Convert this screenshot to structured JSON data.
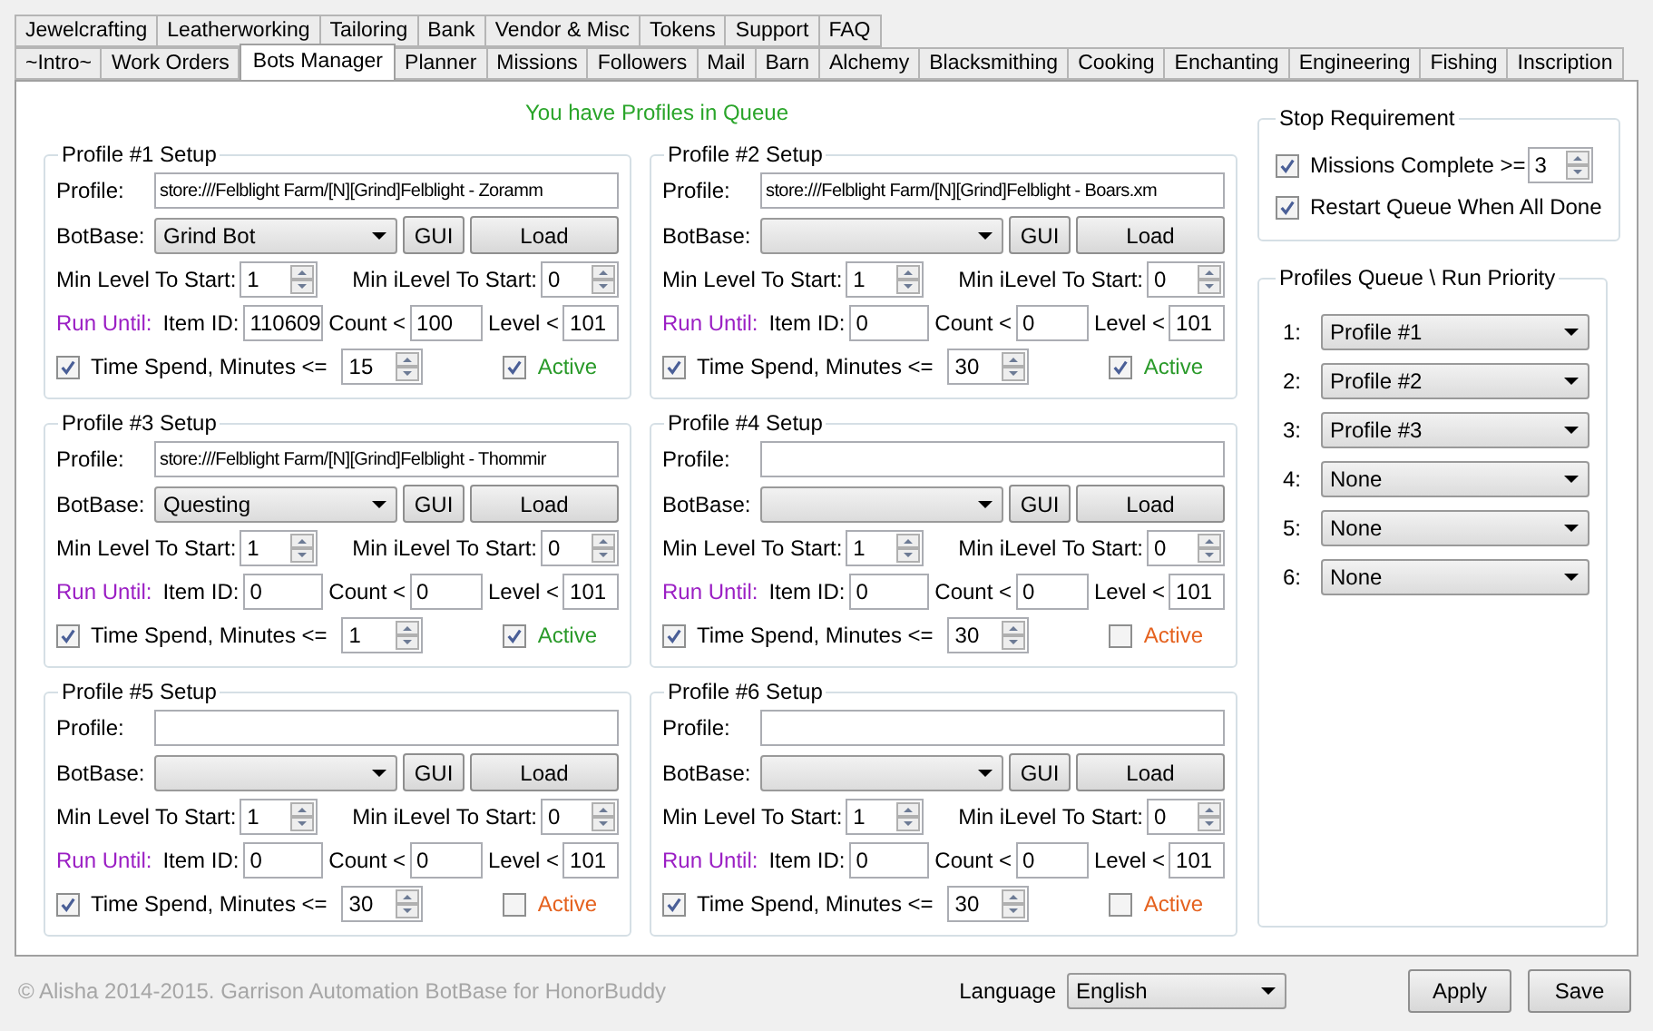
{
  "tabs_row_1": [
    {
      "label": "Jewelcrafting",
      "selected": false
    },
    {
      "label": "Leatherworking",
      "selected": false
    },
    {
      "label": "Tailoring",
      "selected": false
    },
    {
      "label": "Bank",
      "selected": false
    },
    {
      "label": "Vendor & Misc",
      "selected": false
    },
    {
      "label": "Tokens",
      "selected": false
    },
    {
      "label": "Support",
      "selected": false
    },
    {
      "label": "FAQ",
      "selected": false
    }
  ],
  "tabs_row_2": [
    {
      "label": "~Intro~",
      "selected": false
    },
    {
      "label": "Work Orders",
      "selected": false
    },
    {
      "label": "Bots Manager",
      "selected": true
    },
    {
      "label": "Planner",
      "selected": false
    },
    {
      "label": "Missions",
      "selected": false
    },
    {
      "label": "Followers",
      "selected": false
    },
    {
      "label": "Mail",
      "selected": false
    },
    {
      "label": "Barn",
      "selected": false
    },
    {
      "label": "Alchemy",
      "selected": false
    },
    {
      "label": "Blacksmithing",
      "selected": false
    },
    {
      "label": "Cooking",
      "selected": false
    },
    {
      "label": "Enchanting",
      "selected": false
    },
    {
      "label": "Engineering",
      "selected": false
    },
    {
      "label": "Fishing",
      "selected": false
    },
    {
      "label": "Inscription",
      "selected": false
    }
  ],
  "status_message": "You have Profiles in Queue",
  "profiles": [
    {
      "title": "Profile #1 Setup",
      "profile_label": "Profile:",
      "profile_path": "store:///Felblight Farm/[N][Grind]Felblight - Zoramm",
      "botbase_label": "BotBase:",
      "botbase": "Grind Bot",
      "gui_button": "GUI",
      "load_button": "Load",
      "min_level_label": "Min Level To Start:",
      "min_level": "1",
      "min_ilevel_label": "Min iLevel To Start:",
      "min_ilevel": "0",
      "run_until_label": "Run Until:",
      "item_id_label": "Item ID:",
      "item_id": "110609",
      "count_label": "Count <",
      "count": "100",
      "level_label": "Level <",
      "level_limit": "101",
      "time_label": "Time Spend, Minutes <=",
      "time_checked": true,
      "minutes": "15",
      "active_label": "Active",
      "active": true
    },
    {
      "title": "Profile #2 Setup",
      "profile_label": "Profile:",
      "profile_path": "store:///Felblight Farm/[N][Grind]Felblight - Boars.xm",
      "botbase_label": "BotBase:",
      "gui_button": "GUI",
      "load_button": "Load",
      "min_level_label": "Min Level To Start:",
      "min_level": "1",
      "min_ilevel_label": "Min iLevel To Start:",
      "min_ilevel": "0",
      "run_until_label": "Run Until:",
      "item_id_label": "Item ID:",
      "item_id": "0",
      "count_label": "Count <",
      "count": "0",
      "level_label": "Level <",
      "level_limit": "101",
      "time_label": "Time Spend, Minutes <=",
      "time_checked": true,
      "minutes": "30",
      "active_label": "Active",
      "active": true
    },
    {
      "title": "Profile #3 Setup",
      "profile_label": "Profile:",
      "profile_path": "store:///Felblight Farm/[N][Grind]Felblight - Thommir",
      "botbase_label": "BotBase:",
      "botbase": "Questing",
      "gui_button": "GUI",
      "load_button": "Load",
      "min_level_label": "Min Level To Start:",
      "min_level": "1",
      "min_ilevel_label": "Min iLevel To Start:",
      "min_ilevel": "0",
      "run_until_label": "Run Until:",
      "item_id_label": "Item ID:",
      "item_id": "0",
      "count_label": "Count <",
      "count": "0",
      "level_label": "Level <",
      "level_limit": "101",
      "time_label": "Time Spend, Minutes <=",
      "time_checked": true,
      "minutes": "1",
      "active_label": "Active",
      "active": true
    },
    {
      "title": "Profile #4 Setup",
      "profile_label": "Profile:",
      "botbase_label": "BotBase:",
      "gui_button": "GUI",
      "load_button": "Load",
      "min_level_label": "Min Level To Start:",
      "min_level": "1",
      "min_ilevel_label": "Min iLevel To Start:",
      "min_ilevel": "0",
      "run_until_label": "Run Until:",
      "item_id_label": "Item ID:",
      "item_id": "0",
      "count_label": "Count <",
      "count": "0",
      "level_label": "Level <",
      "level_limit": "101",
      "time_label": "Time Spend, Minutes <=",
      "time_checked": true,
      "minutes": "30",
      "active_label": "Active",
      "active": false
    },
    {
      "title": "Profile #5 Setup",
      "profile_label": "Profile:",
      "botbase_label": "BotBase:",
      "gui_button": "GUI",
      "load_button": "Load",
      "min_level_label": "Min Level To Start:",
      "min_level": "1",
      "min_ilevel_label": "Min iLevel To Start:",
      "min_ilevel": "0",
      "run_until_label": "Run Until:",
      "item_id_label": "Item ID:",
      "item_id": "0",
      "count_label": "Count <",
      "count": "0",
      "level_label": "Level <",
      "level_limit": "101",
      "time_label": "Time Spend, Minutes <=",
      "time_checked": true,
      "minutes": "30",
      "active_label": "Active",
      "active": false
    },
    {
      "title": "Profile #6 Setup",
      "profile_label": "Profile:",
      "botbase_label": "BotBase:",
      "gui_button": "GUI",
      "load_button": "Load",
      "min_level_label": "Min Level To Start:",
      "min_level": "1",
      "min_ilevel_label": "Min iLevel To Start:",
      "min_ilevel": "0",
      "run_until_label": "Run Until:",
      "item_id_label": "Item ID:",
      "item_id": "0",
      "count_label": "Count <",
      "count": "0",
      "level_label": "Level <",
      "level_limit": "101",
      "time_label": "Time Spend, Minutes <=",
      "time_checked": true,
      "minutes": "30",
      "active_label": "Active",
      "active": false
    }
  ],
  "stop_requirement": {
    "title": "Stop Requirement",
    "missions_label": "Missions Complete >=",
    "missions_checked": true,
    "missions_value": "3",
    "restart_label": "Restart Queue When All Done",
    "restart_checked": true
  },
  "queue": {
    "title": "Profiles Queue \\ Run Priority",
    "slots": [
      {
        "number": "1:",
        "value": "Profile #1"
      },
      {
        "number": "2:",
        "value": "Profile #2"
      },
      {
        "number": "3:",
        "value": "Profile #3"
      },
      {
        "number": "4:",
        "value": "None"
      },
      {
        "number": "5:",
        "value": "None"
      },
      {
        "number": "6:",
        "value": "None"
      }
    ]
  },
  "footer": {
    "copyright": "© Alisha 2014-2015. Garrison Automation BotBase for HonorBuddy",
    "language_label": "Language",
    "language": "English",
    "apply_button": "Apply",
    "save_button": "Save"
  }
}
